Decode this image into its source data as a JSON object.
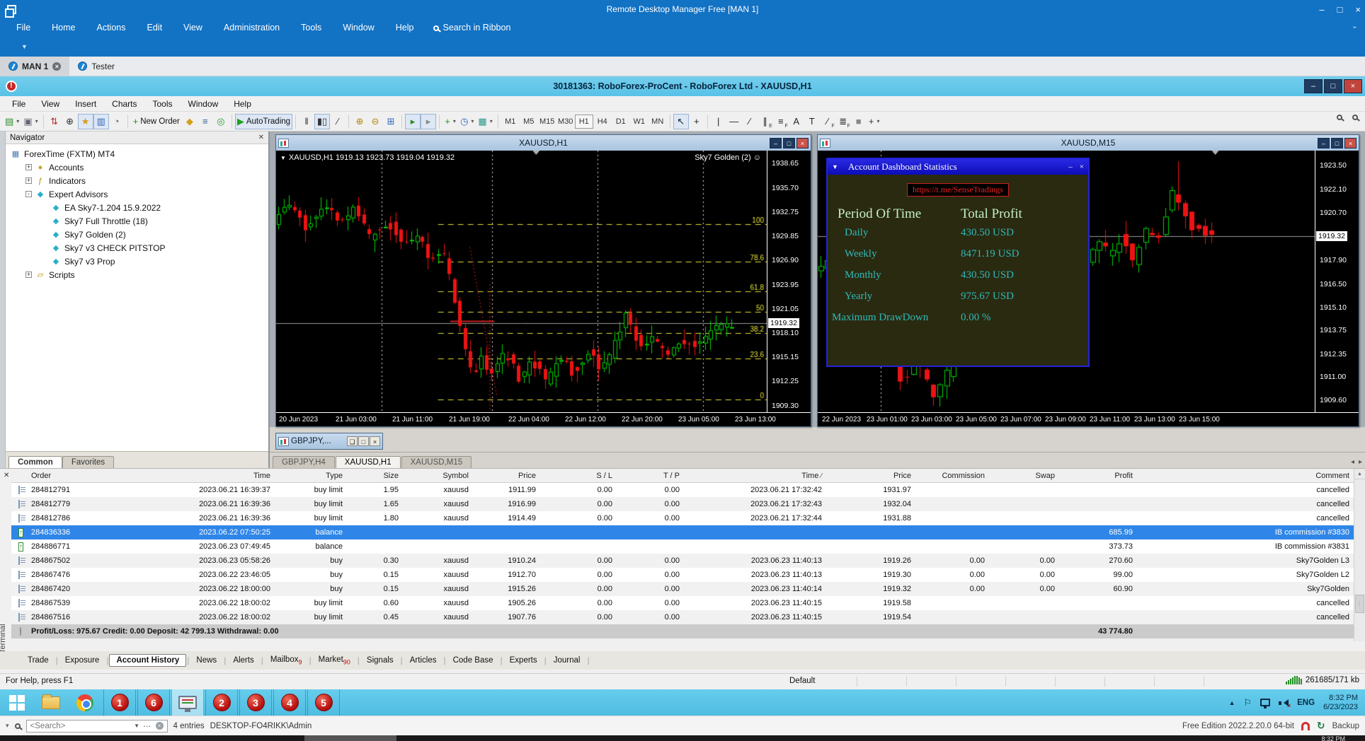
{
  "rdm": {
    "title": "Remote Desktop Manager Free [MAN 1]",
    "menu": [
      "File",
      "Home",
      "Actions",
      "Edit",
      "View",
      "Administration",
      "Tools",
      "Window",
      "Help"
    ],
    "search_in_ribbon": "Search in Ribbon",
    "tabs": [
      {
        "label": "MAN 1",
        "active": true,
        "closable": true
      },
      {
        "label": "Tester",
        "active": false,
        "closable": false
      }
    ],
    "statusbar": {
      "search_placeholder": "<Search>",
      "entries_count": "4 entries",
      "host": "DESKTOP-FO4RIKK\\Admin",
      "edition": "Free Edition 2022.2.20.0 64-bit",
      "backup_label": "Backup"
    }
  },
  "mt4": {
    "window_title": "30181363: RoboForex-ProCent - RoboForex Ltd - XAUUSD,H1",
    "menu": [
      "File",
      "View",
      "Insert",
      "Charts",
      "Tools",
      "Window",
      "Help"
    ],
    "toolbar": {
      "left": [
        {
          "name": "new-chart-icon",
          "glyph": "▤",
          "color": "#2d8f2d",
          "dd": true
        },
        {
          "name": "profiles-icon",
          "glyph": "▣",
          "color": "#667",
          "dd": true
        },
        {
          "sep": true
        },
        {
          "name": "market-watch-icon",
          "glyph": "⇅",
          "color": "#b03030"
        },
        {
          "name": "data-window-icon",
          "glyph": "⊕",
          "color": "#333"
        },
        {
          "name": "navigator-icon",
          "glyph": "★",
          "color": "#d99a1f",
          "pressed": true
        },
        {
          "name": "terminal-icon",
          "glyph": "▥",
          "color": "#3366bb",
          "pressed": true
        },
        {
          "name": "strategy-tester-icon",
          "glyph": "◔",
          "color": "#666"
        },
        {
          "sep": true
        },
        {
          "name": "new-order-icon",
          "glyph": "+",
          "color": "#1a9a1a",
          "label": "New Order"
        },
        {
          "name": "metaeditor-icon",
          "glyph": "◆",
          "color": "#d4a017"
        },
        {
          "name": "print-icon",
          "glyph": "≡",
          "color": "#336699"
        },
        {
          "name": "signals-icon",
          "glyph": "◎",
          "color": "#2a9a2a"
        },
        {
          "sep": true
        },
        {
          "name": "autotrading-icon",
          "glyph": "▶",
          "color": "#1fa01f",
          "label": "AutoTrading",
          "pressed": true
        },
        {
          "sep": true
        },
        {
          "name": "bar-chart-icon",
          "glyph": "‖",
          "color": "#333"
        },
        {
          "name": "candlestick-icon",
          "glyph": "▮▯",
          "color": "#333",
          "pressed": true
        },
        {
          "name": "line-chart-icon",
          "glyph": "∕",
          "color": "#333"
        },
        {
          "sep": true
        },
        {
          "name": "zoom-in-icon",
          "glyph": "⊕",
          "color": "#b8860b"
        },
        {
          "name": "zoom-out-icon",
          "glyph": "⊖",
          "color": "#b8860b"
        },
        {
          "name": "tile-windows-icon",
          "glyph": "⊞",
          "color": "#3366bb"
        },
        {
          "sep": true
        },
        {
          "name": "auto-scroll-icon",
          "glyph": "▸",
          "color": "#2a8a2a",
          "pressed": true
        },
        {
          "name": "chart-shift-icon",
          "glyph": "▸",
          "color": "#888",
          "pressed": true
        },
        {
          "sep": true
        },
        {
          "name": "indicators-icon",
          "glyph": "+",
          "color": "#1a9a1a",
          "dd": true
        },
        {
          "name": "periods-icon",
          "glyph": "◷",
          "color": "#3366bb",
          "dd": true
        },
        {
          "name": "templates-icon",
          "glyph": "▦",
          "color": "#2a9988",
          "dd": true
        },
        {
          "sep": true
        }
      ],
      "timeframes": [
        "M1",
        "M5",
        "M15",
        "M30",
        "H1",
        "H4",
        "D1",
        "W1",
        "MN"
      ],
      "active_timeframe": "H1",
      "tools": [
        {
          "sep": true
        },
        {
          "name": "cursor-icon",
          "glyph": "↖",
          "color": "#222",
          "pressed": true
        },
        {
          "name": "crosshair-icon",
          "glyph": "+",
          "color": "#222"
        },
        {
          "sep": true
        },
        {
          "name": "vertical-line-icon",
          "glyph": "|",
          "color": "#222"
        },
        {
          "name": "horizontal-line-icon",
          "glyph": "—",
          "color": "#222"
        },
        {
          "name": "trendline-icon",
          "glyph": "∕",
          "color": "#222"
        },
        {
          "name": "channel-icon",
          "glyph": "∥",
          "color": "#222",
          "sub": "E"
        },
        {
          "name": "fibonacci-icon",
          "glyph": "≡",
          "color": "#222",
          "sub": "F"
        },
        {
          "name": "text-icon",
          "glyph": "A",
          "color": "#222"
        },
        {
          "name": "text-label-icon",
          "glyph": "T",
          "color": "#222"
        },
        {
          "name": "fibo-fan-icon",
          "glyph": "∕",
          "color": "#222",
          "sub": "F"
        },
        {
          "name": "fibo-expansion-icon",
          "glyph": "≣",
          "color": "#222",
          "sub": "F"
        },
        {
          "name": "shapes-icon",
          "glyph": "■",
          "color": "#888"
        },
        {
          "name": "arrows-icon",
          "glyph": "+",
          "color": "#333",
          "dd": true
        }
      ]
    },
    "navigator": {
      "title": "Navigator",
      "tree": [
        {
          "label": "ForexTime (FXTM) MT4",
          "icon": "server-icon",
          "level": 0
        },
        {
          "label": "Accounts",
          "icon": "accounts-icon",
          "level": 1,
          "expander": "+"
        },
        {
          "label": "Indicators",
          "icon": "indicators-tree-icon",
          "level": 1,
          "expander": "+"
        },
        {
          "label": "Expert Advisors",
          "icon": "experts-icon",
          "level": 1,
          "expander": "-"
        },
        {
          "label": "EA Sky7-1.204 15.9.2022",
          "icon": "expert-icon",
          "level": 2
        },
        {
          "label": "Sky7 Full Throttle (18)",
          "icon": "expert-icon",
          "level": 2
        },
        {
          "label": "Sky7 Golden (2)",
          "icon": "expert-icon",
          "level": 2
        },
        {
          "label": "Sky7 v3 CHECK PITSTOP",
          "icon": "expert-icon",
          "level": 2
        },
        {
          "label": "Sky7 v3 Prop",
          "icon": "expert-icon",
          "level": 2
        },
        {
          "label": "Scripts",
          "icon": "scripts-icon",
          "level": 1,
          "expander": "+"
        }
      ],
      "tabs": [
        {
          "label": "Common",
          "active": true
        },
        {
          "label": "Favorites",
          "active": false
        }
      ]
    },
    "icon_glyphs": {
      "server-icon": [
        "▦",
        "#4a7ab5"
      ],
      "accounts-icon": [
        "●",
        "#caa21f"
      ],
      "indicators-tree-icon": [
        "ƒ",
        "#b8860b"
      ],
      "experts-icon": [
        "◆",
        "#2ab0c8"
      ],
      "expert-icon": [
        "◆",
        "#2ab0c8"
      ],
      "scripts-icon": [
        "▱",
        "#b8860b"
      ]
    },
    "charts": {
      "h1": {
        "title": "XAUUSD,H1",
        "ohlc_label": "XAUUSD,H1  1919.13 1923.73 1919.04 1919.32",
        "ea_label": "Sky7 Golden (2)",
        "ea_smiley": "☺",
        "price_ticks": [
          "1938.65",
          "1935.70",
          "1932.75",
          "1929.85",
          "1926.90",
          "1923.95",
          "1921.05",
          "1918.10",
          "1915.15",
          "1912.25",
          "1909.30"
        ],
        "current_price": "1919.32",
        "fib_levels": [
          {
            "label": "100",
            "pct": 100
          },
          {
            "label": "78.6",
            "pct": 78.6
          },
          {
            "label": "61.8",
            "pct": 61.8
          },
          {
            "label": "50",
            "pct": 50
          },
          {
            "label": "38.2",
            "pct": 38.2
          },
          {
            "label": "23.6",
            "pct": 23.6
          },
          {
            "label": "0",
            "pct": 0
          }
        ],
        "time_ticks": [
          "20 Jun 2023",
          "21 Jun 03:00",
          "21 Jun 11:00",
          "21 Jun 19:00",
          "22 Jun 04:00",
          "22 Jun 12:00",
          "22 Jun 20:00",
          "23 Jun 05:00",
          "23 Jun 13:00"
        ]
      },
      "m15": {
        "title": "XAUUSD,M15",
        "price_ticks": [
          "1923.50",
          "1922.10",
          "1920.70",
          "1919.30",
          "1917.90",
          "1916.50",
          "1915.10",
          "1913.75",
          "1912.35",
          "1911.00",
          "1909.60"
        ],
        "current_price": "1919.32",
        "time_ticks": [
          "22 Jun 2023",
          "23 Jun 01:00",
          "23 Jun 03:00",
          "23 Jun 05:00",
          "23 Jun 07:00",
          "23 Jun 09:00",
          "23 Jun 11:00",
          "23 Jun 13:00",
          "23 Jun 15:00"
        ]
      },
      "minimized_title": "GBPJPY,...",
      "tabs": [
        {
          "label": "GBPJPY,H4",
          "active": false
        },
        {
          "label": "XAUUSD,H1",
          "active": true
        },
        {
          "label": "XAUUSD,M15",
          "active": false
        }
      ]
    },
    "dashboard": {
      "title": "Account Dashboard Statistics",
      "link": "https://t.me/SenseTradings",
      "header_period": "Period Of Time",
      "header_profit": "Total Profit",
      "rows": [
        {
          "label": "Daily",
          "value": "430.50 USD"
        },
        {
          "label": "Weekly",
          "value": "8471.19 USD"
        },
        {
          "label": "Monthly",
          "value": "430.50 USD"
        },
        {
          "label": "Yearly",
          "value": "975.67 USD"
        },
        {
          "label": "Maximum DrawDown",
          "value": "0.00 %"
        }
      ]
    },
    "terminal": {
      "side_label": "Terminal",
      "columns": [
        "Order",
        "Time",
        "Type",
        "Size",
        "Symbol",
        "Price",
        "S / L",
        "T / P",
        "Time",
        "Price",
        "Commission",
        "Swap",
        "Profit",
        "Comment"
      ],
      "sorted_column_index": 8,
      "rows": [
        {
          "icon": "order",
          "cells": [
            "284812791",
            "2023.06.21 16:39:37",
            "buy limit",
            "1.95",
            "xauusd",
            "1911.99",
            "0.00",
            "0.00",
            "2023.06.21 17:32:42",
            "1931.97",
            "",
            "",
            "",
            "cancelled"
          ]
        },
        {
          "icon": "order",
          "cells": [
            "284812779",
            "2023.06.21 16:39:36",
            "buy limit",
            "1.65",
            "xauusd",
            "1916.99",
            "0.00",
            "0.00",
            "2023.06.21 17:32:43",
            "1932.04",
            "",
            "",
            "",
            "cancelled"
          ]
        },
        {
          "icon": "order",
          "cells": [
            "284812786",
            "2023.06.21 16:39:36",
            "buy limit",
            "1.80",
            "xauusd",
            "1914.49",
            "0.00",
            "0.00",
            "2023.06.21 17:32:44",
            "1931.88",
            "",
            "",
            "",
            "cancelled"
          ]
        },
        {
          "icon": "balance",
          "selected": true,
          "cells": [
            "284836336",
            "2023.06.22 07:50:25",
            "balance",
            "",
            "",
            "",
            "",
            "",
            "",
            "",
            "",
            "",
            "685.99",
            "IB commission #3830"
          ]
        },
        {
          "icon": "balance",
          "cells": [
            "284886771",
            "2023.06.23 07:49:45",
            "balance",
            "",
            "",
            "",
            "",
            "",
            "",
            "",
            "",
            "",
            "373.73",
            "IB commission #3831"
          ]
        },
        {
          "icon": "order",
          "cells": [
            "284867502",
            "2023.06.23 05:58:26",
            "buy",
            "0.30",
            "xauusd",
            "1910.24",
            "0.00",
            "0.00",
            "2023.06.23 11:40:13",
            "1919.26",
            "0.00",
            "0.00",
            "270.60",
            "Sky7Golden L3"
          ]
        },
        {
          "icon": "order",
          "cells": [
            "284867476",
            "2023.06.22 23:46:05",
            "buy",
            "0.15",
            "xauusd",
            "1912.70",
            "0.00",
            "0.00",
            "2023.06.23 11:40:13",
            "1919.30",
            "0.00",
            "0.00",
            "99.00",
            "Sky7Golden L2"
          ]
        },
        {
          "icon": "order",
          "cells": [
            "284867420",
            "2023.06.22 18:00:00",
            "buy",
            "0.15",
            "xauusd",
            "1915.26",
            "0.00",
            "0.00",
            "2023.06.23 11:40:14",
            "1919.32",
            "0.00",
            "0.00",
            "60.90",
            "Sky7Golden"
          ]
        },
        {
          "icon": "order",
          "cells": [
            "284867539",
            "2023.06.22 18:00:02",
            "buy limit",
            "0.60",
            "xauusd",
            "1905.26",
            "0.00",
            "0.00",
            "2023.06.23 11:40:15",
            "1919.58",
            "",
            "",
            "",
            "cancelled"
          ]
        },
        {
          "icon": "order",
          "cells": [
            "284867516",
            "2023.06.22 18:00:02",
            "buy limit",
            "0.45",
            "xauusd",
            "1907.76",
            "0.00",
            "0.00",
            "2023.06.23 11:40:15",
            "1919.54",
            "",
            "",
            "",
            "cancelled"
          ]
        }
      ],
      "summary": {
        "text": "Profit/Loss: 975.67  Credit: 0.00  Deposit: 42 799.13  Withdrawal: 0.00",
        "profit_total": "43 774.80"
      },
      "tabs": [
        {
          "label": "Trade"
        },
        {
          "label": "Exposure"
        },
        {
          "label": "Account History",
          "active": true
        },
        {
          "label": "News"
        },
        {
          "label": "Alerts"
        },
        {
          "label": "Mailbox",
          "badge": "9"
        },
        {
          "label": "Market",
          "badge": "90"
        },
        {
          "label": "Signals"
        },
        {
          "label": "Articles"
        },
        {
          "label": "Code Base"
        },
        {
          "label": "Experts"
        },
        {
          "label": "Journal"
        }
      ]
    },
    "statusbar": {
      "help": "For Help, press F1",
      "profile": "Default",
      "connection": "261685/171 kb"
    }
  },
  "taskbar": {
    "apps": [
      {
        "name": "start-button",
        "type": "start"
      },
      {
        "name": "explorer-icon",
        "type": "explorer"
      },
      {
        "name": "chrome-icon",
        "type": "chrome"
      },
      {
        "name": "terminal-1-icon",
        "type": "num",
        "label": "1"
      },
      {
        "name": "terminal-6-icon",
        "type": "num",
        "label": "6"
      },
      {
        "name": "monitor-app-icon",
        "type": "monitor",
        "active": true
      },
      {
        "name": "terminal-2-icon",
        "type": "num",
        "label": "2"
      },
      {
        "name": "terminal-3-icon",
        "type": "num",
        "label": "3"
      },
      {
        "name": "terminal-4-icon",
        "type": "num",
        "label": "4"
      },
      {
        "name": "terminal-5-icon",
        "type": "num",
        "label": "5"
      }
    ],
    "tray": {
      "lang": "ENG",
      "time": "8:32 PM",
      "date": "6/23/2023"
    }
  },
  "host_taskbar": {
    "time": "8:32 PM"
  },
  "colors": {
    "rdm_blue": "#1272c4",
    "mt4_titlebar": "#5fc6ea",
    "chart_up": "#00d600",
    "chart_down": "#ee1313",
    "fib_yellow": "#e6e231",
    "selected_row": "#2f86e8",
    "dashboard_bg": "#2a2a10",
    "dashboard_text": "#2fb9b9",
    "dashboard_header": "#c4f0c6",
    "dashboard_link": "#ee2222"
  }
}
